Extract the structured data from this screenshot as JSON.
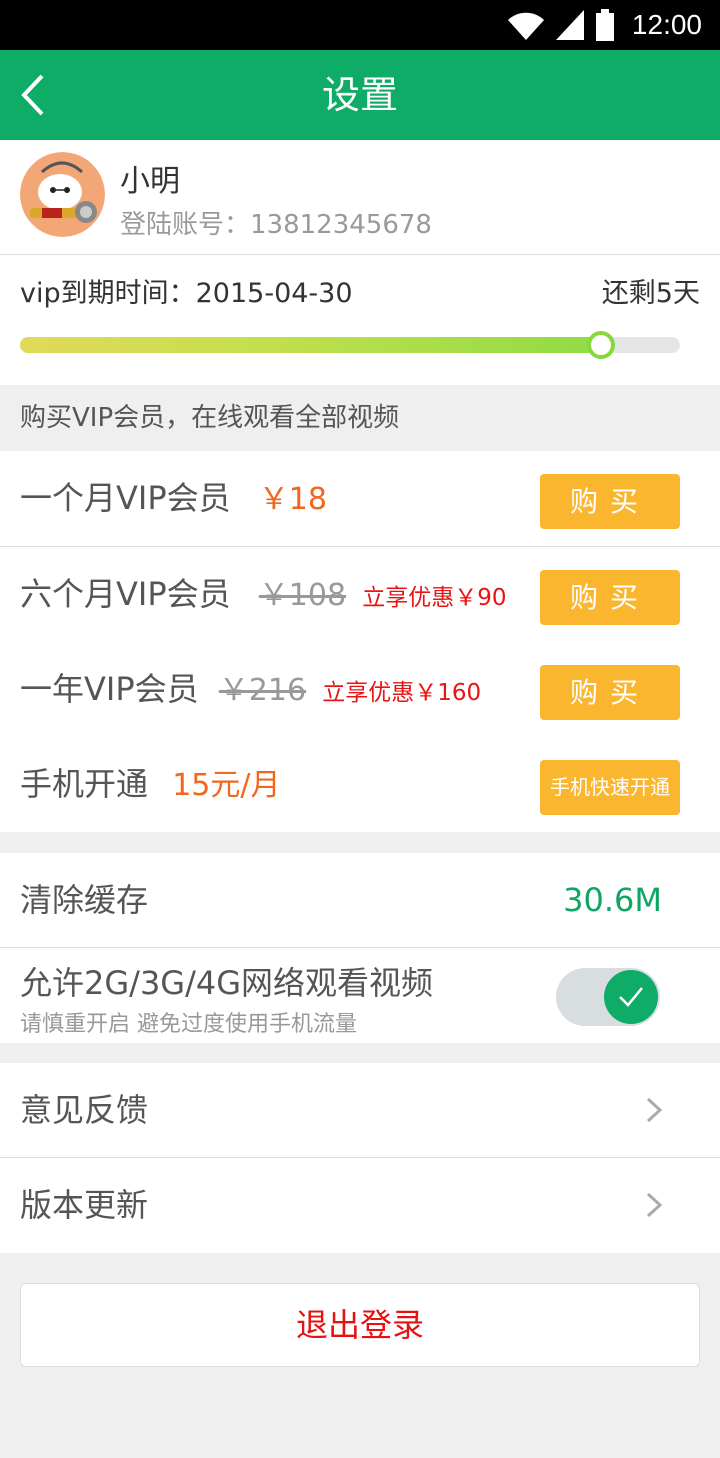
{
  "status_bar": {
    "time": "12:00",
    "icons": [
      "wifi-icon",
      "signal-icon",
      "battery-icon"
    ]
  },
  "header": {
    "title": "设置",
    "back_icon": "back-arrow-icon"
  },
  "profile": {
    "name": "小明",
    "account_label": "登陆账号：13812345678"
  },
  "vip": {
    "expire_label": "vip到期时间：2015-04-30",
    "remaining": "还剩5天",
    "progress": 0.88
  },
  "section_header": "购买VIP会员，在线观看全部视频",
  "plans": [
    {
      "name": "一个月VIP会员",
      "price": "￥18",
      "old_price": "",
      "promo": "",
      "button": "购买"
    },
    {
      "name": "六个月VIP会员",
      "price": "",
      "old_price": "￥108",
      "promo": "立享优惠￥90",
      "button": "购买"
    },
    {
      "name": "一年VIP会员",
      "price": "",
      "old_price": "￥216",
      "promo": "立享优惠￥160",
      "button": "购买"
    },
    {
      "name": "手机开通",
      "price": "15元/月",
      "old_price": "",
      "promo": "",
      "button": "手机快速开通"
    }
  ],
  "settings": {
    "cache_label": "清除缓存",
    "cache_size": "30.6M",
    "network_label": "允许2G/3G/4G网络观看视频",
    "network_sub": "请慎重开启 避免过度使用手机流量",
    "network_enabled": true
  },
  "menu": [
    {
      "label": "意见反馈"
    },
    {
      "label": "版本更新"
    }
  ],
  "logout_label": "退出登录",
  "colors": {
    "primary": "#0fac68",
    "buy_button": "#fbb630",
    "price": "#f2661e",
    "promo": "#e81414"
  }
}
